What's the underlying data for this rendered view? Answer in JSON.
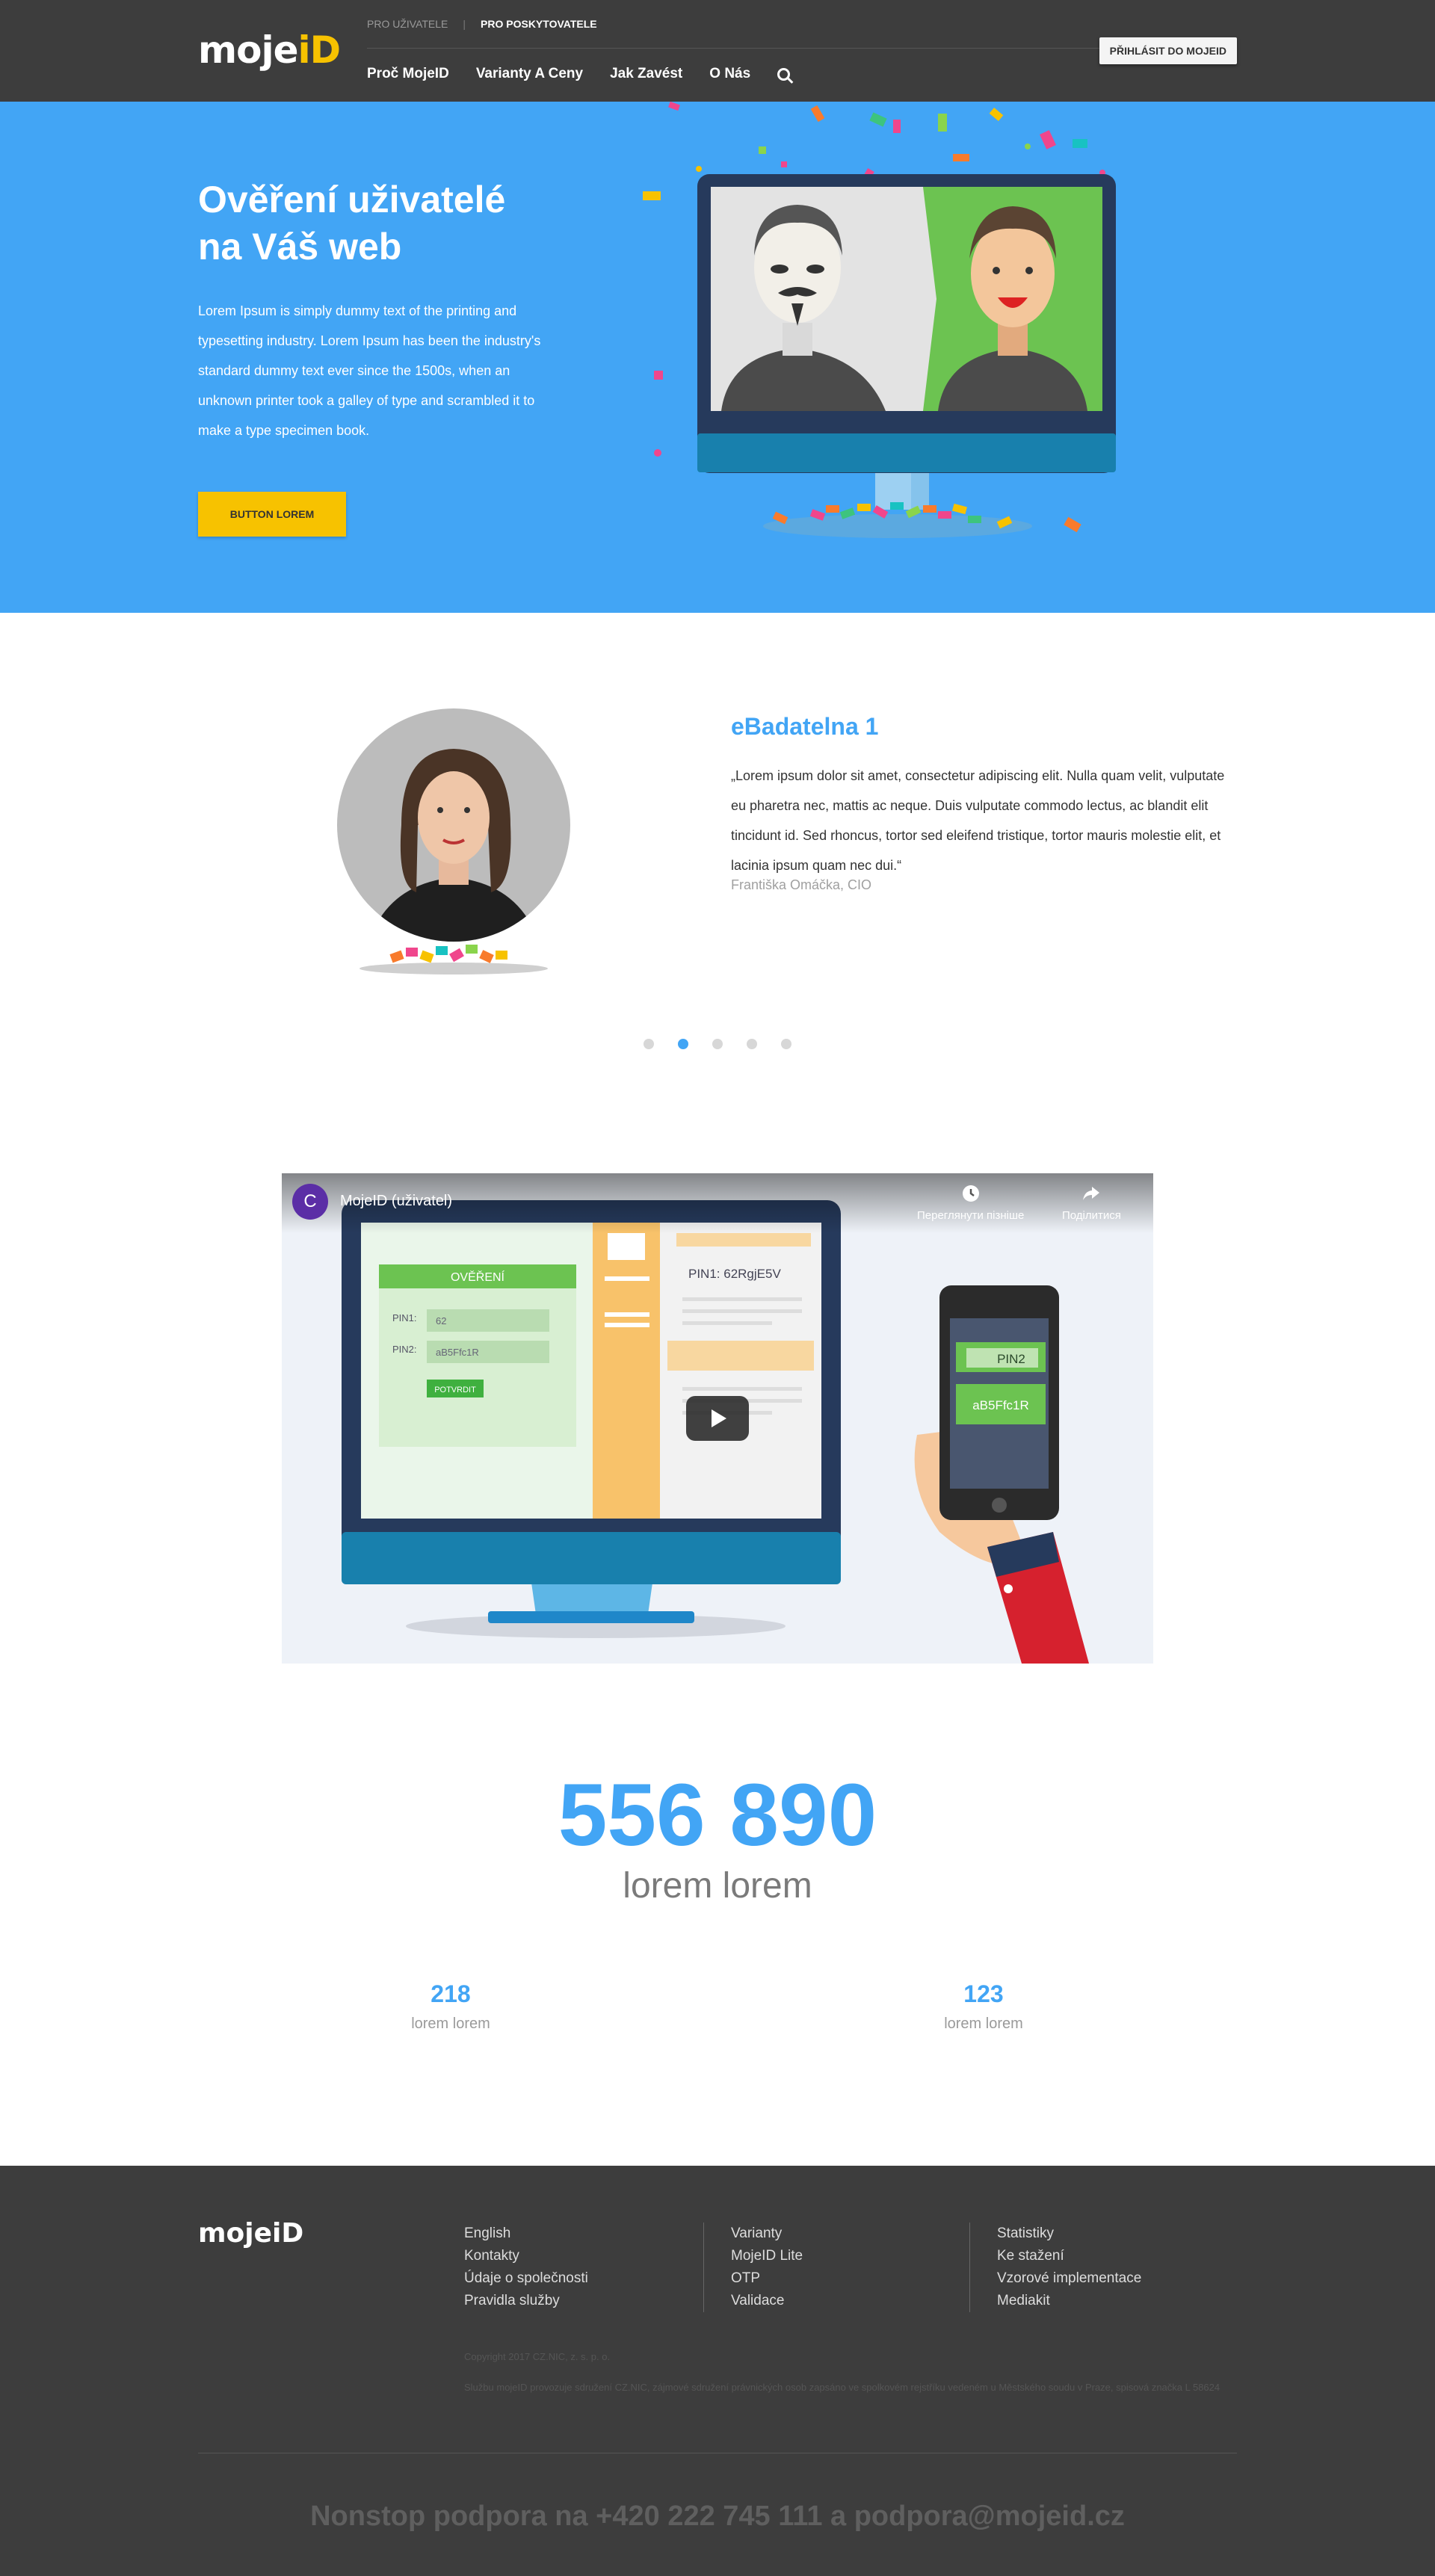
{
  "header": {
    "logo": {
      "text": "moje",
      "accent": "iD"
    },
    "top_links": [
      "PRO UŽIVATELE",
      "PRO POSKYTOVATELE"
    ],
    "top_separator": "|",
    "nav": [
      "Proč MojeID",
      "Varianty A Ceny",
      "Jak Zavést",
      "O Nás"
    ],
    "login_label": "PŘIHLÁSIT DO MOJEID"
  },
  "hero": {
    "title_line1": "Ověření uživatelé",
    "title_line2": "na Váš web",
    "text": "Lorem Ipsum is simply dummy text of the printing and typesetting industry. Lorem Ipsum has been the industry's standard dummy text ever since the 1500s, when an unknown printer took a galley of type and scrambled it to make a type specimen book.",
    "button_label": "BUTTON LOREM"
  },
  "testimonial": {
    "title": "eBadatelna 1",
    "quote": "„Lorem ipsum dolor sit amet, consectetur adipiscing elit. Nulla quam velit, vulputate eu pharetra nec, mattis ac neque. Duis vulputate commodo lectus, ac blandit elit tincidunt id. Sed rhoncus, tortor sed eleifend tristique, tortor mauris molestie elit, et lacinia ipsum quam nec dui.“",
    "author": "Františka Omáčka, CIO",
    "active_dot": 2,
    "dot_count": 5
  },
  "video": {
    "channel_initial": "C",
    "title": "MojeID (uživatel)",
    "watch_later": "Переглянути пізніше",
    "share": "Поділитися",
    "form_title": "OVĚŘENÍ",
    "pin1_label": "PIN1:",
    "pin1_value": "62",
    "pin2_label": "PIN2:",
    "pin2_value": "aB5Ffc1R",
    "confirm": "POTVRDIT",
    "pin_text": "PIN1: 62RgjE5V",
    "phone_pin_label": "PIN2",
    "phone_pin_value": "aB5Ffc1R"
  },
  "stats": {
    "main_number": "556 890",
    "main_label": "lorem lorem",
    "left_number": "218",
    "left_label": "lorem lorem",
    "right_number": "123",
    "right_label": "lorem lorem"
  },
  "footer": {
    "logo": "mojeiD",
    "col1": [
      "English",
      "Kontakty",
      "Údaje o společnosti",
      "Pravidla služby"
    ],
    "col2": [
      "Varianty",
      "MojeID Lite",
      "OTP",
      "Validace"
    ],
    "col3": [
      "Statistiky",
      "Ke stažení",
      "Vzorové implementace",
      "Mediakit"
    ],
    "copyright": "Copyright 2017 CZ.NIC, z. s. p. o.",
    "legal": "Službu mojeID provozuje sdružení CZ.NIC, zájmové sdružení právnických osob zapsáno ve spolkovém rejstříku vedeném u Městského soudu v Praze, spisová značka L 58624",
    "support": "Nonstop podpora na +420 222 745 111 a podpora@mojeid.cz"
  },
  "colors": {
    "accent": "#42a5f5",
    "yellow": "#f7c200",
    "dark": "#3d3d3d"
  }
}
